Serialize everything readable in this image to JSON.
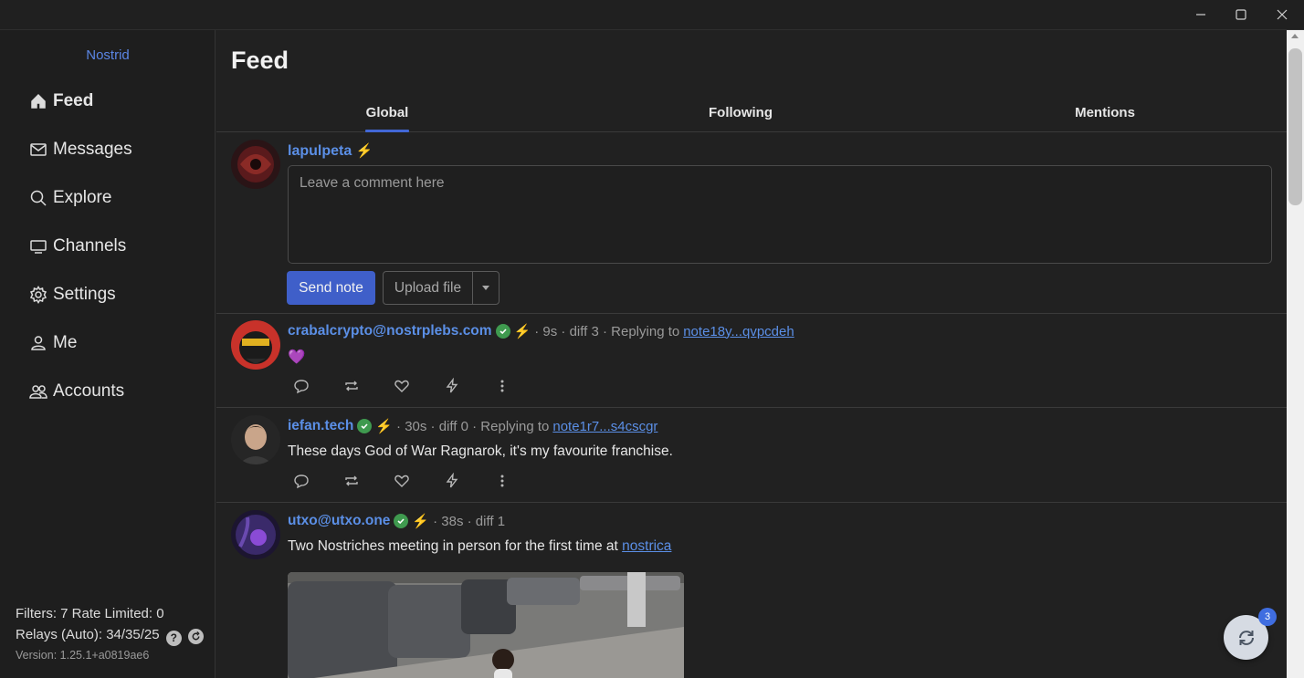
{
  "app": {
    "title": "Nostrid"
  },
  "window_controls": {
    "minimize_icon": "minimize-icon",
    "maximize_icon": "maximize-icon",
    "close_icon": "close-icon"
  },
  "sidebar": {
    "items": [
      {
        "label": "Feed",
        "icon": "home-icon",
        "active": true
      },
      {
        "label": "Messages",
        "icon": "envelope-icon"
      },
      {
        "label": "Explore",
        "icon": "search-icon"
      },
      {
        "label": "Channels",
        "icon": "tv-icon"
      },
      {
        "label": "Settings",
        "icon": "gear-icon"
      },
      {
        "label": "Me",
        "icon": "person-icon"
      },
      {
        "label": "Accounts",
        "icon": "people-icon"
      }
    ],
    "status": {
      "filters": "Filters: 7 Rate Limited: 0",
      "relays": "Relays (Auto): 34/35/25",
      "help": "?",
      "version": "Version: 1.25.1+a0819ae6"
    }
  },
  "main": {
    "title": "Feed",
    "tabs": [
      {
        "label": "Global",
        "active": true
      },
      {
        "label": "Following"
      },
      {
        "label": "Mentions"
      }
    ],
    "composer": {
      "user": "lapulpeta",
      "placeholder": "Leave a comment here",
      "send_label": "Send note",
      "upload_label": "Upload file"
    },
    "posts": [
      {
        "author": "crabalcrypto@nostrplebs.com",
        "meta": "· 9s · diff 3 · Replying to",
        "reply_link": "note18y...qvpcdeh",
        "body": "💜"
      },
      {
        "author": "iefan.tech",
        "meta": "· 30s · diff 0 · Replying to",
        "reply_link": "note1r7...s4cscgr",
        "body": "These days God of War Ragnarok, it's my favourite franchise."
      },
      {
        "author": "utxo@utxo.one",
        "meta": "· 38s · diff 1",
        "body": "Two Nostriches meeting in person for the first time at",
        "body_link": "nostrica"
      }
    ]
  },
  "refresh": {
    "badge": "3"
  },
  "colors": {
    "accent": "#4267d6",
    "link": "#5b8fe6",
    "verified": "#3f9a4f",
    "zap": "#f1c232"
  }
}
